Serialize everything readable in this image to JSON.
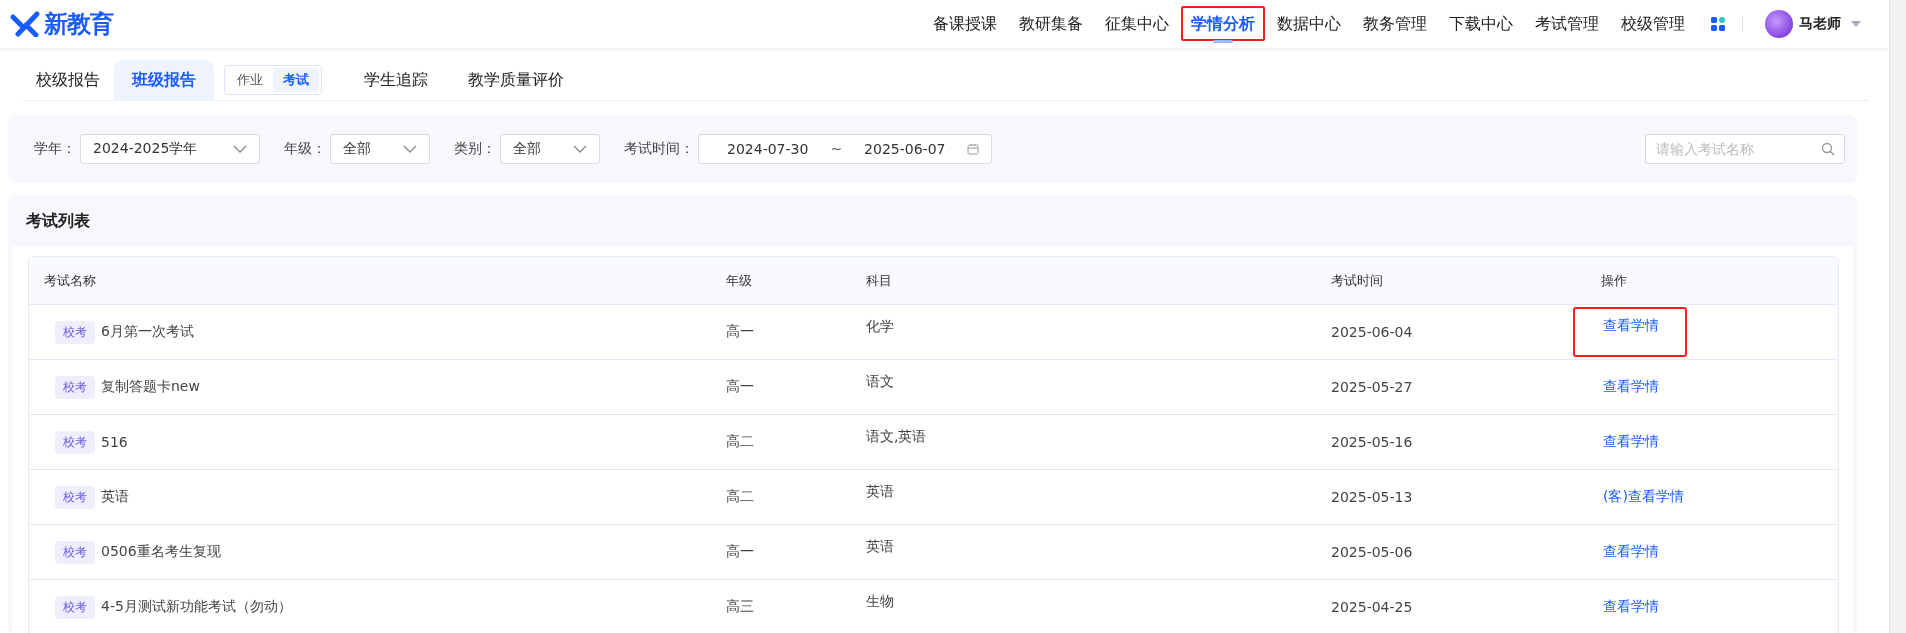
{
  "logo": {
    "text": "新教育"
  },
  "nav": [
    {
      "label": "备课授课",
      "selected": false,
      "highlighted": false
    },
    {
      "label": "教研集备",
      "selected": false,
      "highlighted": false
    },
    {
      "label": "征集中心",
      "selected": false,
      "highlighted": false
    },
    {
      "label": "学情分析",
      "selected": true,
      "highlighted": true
    },
    {
      "label": "数据中心",
      "selected": false,
      "highlighted": false
    },
    {
      "label": "教务管理",
      "selected": false,
      "highlighted": false
    },
    {
      "label": "下载中心",
      "selected": false,
      "highlighted": false
    },
    {
      "label": "考试管理",
      "selected": false,
      "highlighted": false
    },
    {
      "label": "校级管理",
      "selected": false,
      "highlighted": false
    }
  ],
  "user": {
    "name": "马老师"
  },
  "tabs": [
    {
      "label": "校级报告",
      "selected": false
    },
    {
      "label": "班级报告",
      "selected": true
    },
    {
      "label": "学生追踪",
      "selected": false
    },
    {
      "label": "教学质量评价",
      "selected": false
    }
  ],
  "report_type": [
    {
      "label": "作业",
      "selected": false
    },
    {
      "label": "考试",
      "selected": true
    }
  ],
  "filters": [
    {
      "label": "学年：",
      "value": "2024-2025学年"
    },
    {
      "label": "年级：",
      "value": "全部"
    },
    {
      "label": "类别：",
      "value": "全部"
    }
  ],
  "date_range": {
    "label": "考试时间：",
    "start": "2024-07-30",
    "separator": "~",
    "end": "2025-06-07"
  },
  "search": {
    "placeholder": "请输入考试名称"
  },
  "table": {
    "title": "考试列表",
    "columns": [
      "考试名称",
      "年级",
      "科目",
      "考试时间",
      "操作"
    ],
    "rows": [
      {
        "tag": "校考",
        "name": "6月第一次考试",
        "grade": "高一",
        "subject": "化学",
        "date": "2025-06-04",
        "action": "查看学情",
        "highlighted": true
      },
      {
        "tag": "校考",
        "name": "复制答题卡new",
        "grade": "高一",
        "subject": "语文",
        "date": "2025-05-27",
        "action": "查看学情",
        "highlighted": false
      },
      {
        "tag": "校考",
        "name": "516",
        "grade": "高二",
        "subject": "语文,英语",
        "date": "2025-05-16",
        "action": "查看学情",
        "highlighted": false
      },
      {
        "tag": "校考",
        "name": "英语",
        "grade": "高二",
        "subject": "英语",
        "date": "2025-05-13",
        "action": "(客)查看学情",
        "highlighted": false
      },
      {
        "tag": "校考",
        "name": "0506重名考生复现",
        "grade": "高一",
        "subject": "英语",
        "date": "2025-05-06",
        "action": "查看学情",
        "highlighted": false
      },
      {
        "tag": "校考",
        "name": "4-5月测试新功能考试（勿动）",
        "grade": "高三",
        "subject": "生物",
        "date": "2025-04-25",
        "action": "查看学情",
        "highlighted": false
      }
    ]
  }
}
